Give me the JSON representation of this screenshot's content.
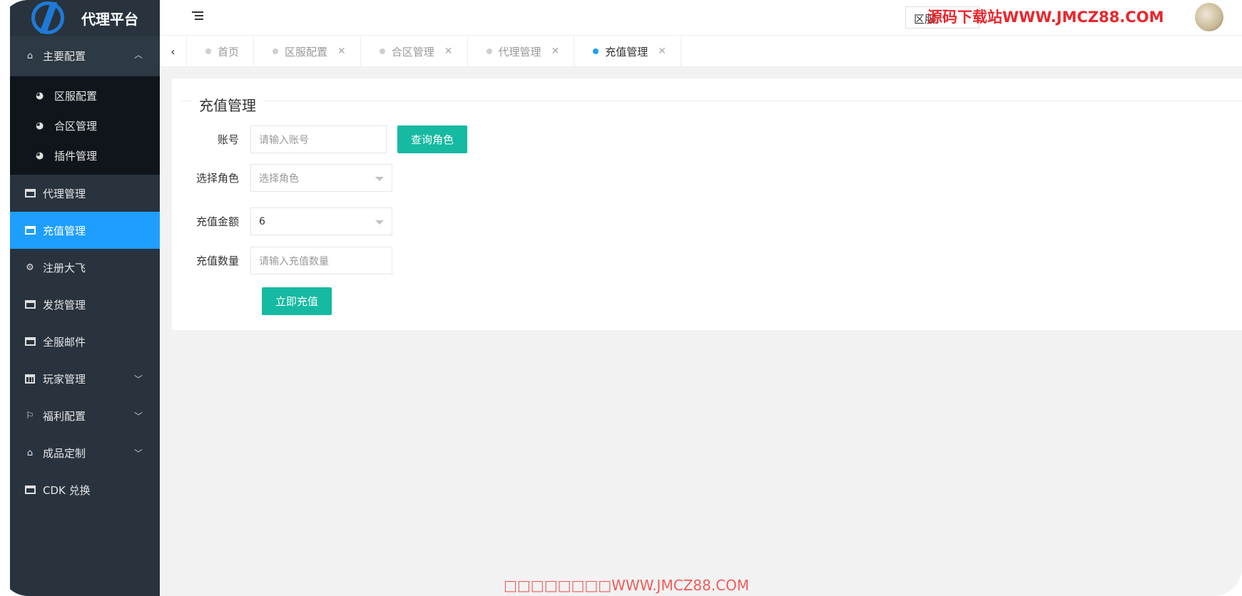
{
  "brand": {
    "title": "代理平台"
  },
  "sidebar": {
    "groups": [
      {
        "label": "主要配置",
        "icon": "home-icon",
        "expanded": true,
        "children": [
          {
            "label": "区服配置",
            "icon": "dashboard-icon"
          },
          {
            "label": "合区管理",
            "icon": "dashboard-icon"
          },
          {
            "label": "插件管理",
            "icon": "dashboard-icon"
          }
        ]
      },
      {
        "label": "代理管理",
        "icon": "window-icon"
      },
      {
        "label": "充值管理",
        "icon": "window-icon",
        "active": true
      },
      {
        "label": "注册大飞",
        "icon": "gears-icon"
      },
      {
        "label": "发货管理",
        "icon": "window-icon"
      },
      {
        "label": "全服邮件",
        "icon": "window-icon"
      },
      {
        "label": "玩家管理",
        "icon": "calendar-icon",
        "expandable": true
      },
      {
        "label": "福利配置",
        "icon": "flag-icon",
        "expandable": true
      },
      {
        "label": "成品定制",
        "icon": "home-icon",
        "expandable": true
      },
      {
        "label": "CDK 兑换",
        "icon": "window-icon"
      }
    ]
  },
  "header": {
    "box_text": "区服",
    "watermark": "源码下载站WWW.JMCZ88.COM"
  },
  "tabs": [
    {
      "label": "首页",
      "closable": false,
      "active": false
    },
    {
      "label": "区服配置",
      "closable": true,
      "active": false
    },
    {
      "label": "合区管理",
      "closable": true,
      "active": false
    },
    {
      "label": "代理管理",
      "closable": true,
      "active": false
    },
    {
      "label": "充值管理",
      "closable": true,
      "active": true
    }
  ],
  "form": {
    "title": "充值管理",
    "account": {
      "label": "账号",
      "placeholder": "请输入账号"
    },
    "query_button": "查询角色",
    "role": {
      "label": "选择角色",
      "value": "选择角色"
    },
    "amount": {
      "label": "充值金额",
      "value": "6"
    },
    "quantity": {
      "label": "充值数量",
      "placeholder": "请输入充值数量"
    },
    "submit_button": "立即充值"
  },
  "footer": {
    "watermark": "□□□□□□□□WWW.JMCZ88.COM"
  },
  "colors": {
    "sidebar_bg": "#28333e",
    "active_blue": "#1e9fff",
    "button_teal": "#16b9a1"
  }
}
